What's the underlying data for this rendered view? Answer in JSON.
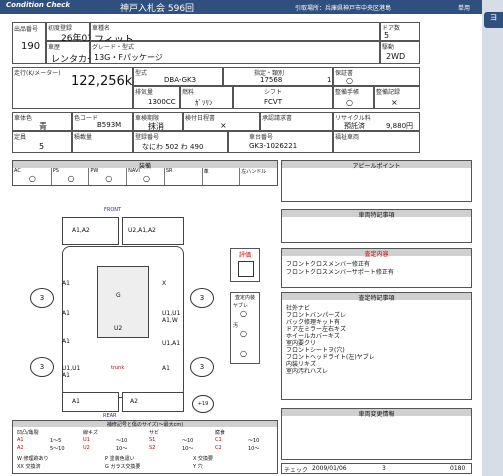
{
  "header": {
    "brand": "Condition Check",
    "auction": "神戸入札会 596回",
    "location": "引取場所：兵庫県神戸市中央区港島",
    "mode": "単用"
  },
  "side_tab": "ヨ",
  "vehicle": {
    "lot_label": "出品番号",
    "lot": "190",
    "first_reg_label": "初度登録",
    "first_reg": "26年03月",
    "name_label": "車種名",
    "name": "フィット",
    "doors_label": "ドア数",
    "doors": "5",
    "type_label": "車歴",
    "type": "レンタカー",
    "grade_label": "グレード・型式",
    "grade": "13G・Fパッケージ",
    "drive_label": "駆動",
    "drive": "2WD",
    "mileage_label": "走行(K/メーター)",
    "mileage": "122,256km",
    "model_label": "型式",
    "model": "DBA-GK3",
    "designation_label": "指定・類別",
    "designation": "17568",
    "category": "1",
    "warranty_label": "保証書",
    "warranty": "○",
    "displacement_label": "排気量",
    "displacement": "1300CC",
    "fuel_label": "燃料",
    "fuel": "ｶﾞｿﾘﾝ",
    "transmission_label": "シフト",
    "transmission": "FCVT",
    "manual_label": "整備手帳",
    "manual": "○",
    "maint_label": "整備記録",
    "maint": "×",
    "color_label": "車体色",
    "color": "青",
    "color_code_label": "色コード",
    "color_code": "B593M",
    "inspect_label": "車検期限",
    "inspect": "抹消",
    "reg_label": "検付日程書",
    "reg": "×",
    "cert_label": "承認請求書",
    "recycle_label": "リサイクル料",
    "recycle_status": "預託済",
    "recycle_fee": "9,880円",
    "capacity_label": "定員",
    "capacity": "5",
    "load_label": "積載量",
    "plate_label": "登録番号",
    "plate": "なにわ 502 わ 490",
    "chassis_label": "車台番号",
    "chassis": "GK3-1026221",
    "welfare_label": "福祉車両"
  },
  "equipment": {
    "title": "装備",
    "headers": [
      "AC",
      "PS",
      "PW",
      "NAVI",
      "SR",
      "革",
      "左ハンドル"
    ],
    "values": [
      "○",
      "○",
      "○",
      "○",
      "",
      "",
      ""
    ]
  },
  "appeal": {
    "title": "アピールポイント"
  },
  "notes_title": "車両特記事項",
  "rating": {
    "label": "評価",
    "value": "",
    "interior_title": "内装評価",
    "interior": ""
  },
  "checks": {
    "title": "査定内容",
    "items": [
      "フロントクロスメンバー修正有",
      "フロントクロスメンバーサポート修正有"
    ]
  },
  "sale_notes": {
    "title": "査定特記事項",
    "items": [
      "社外ナビ",
      "フロントバンパーズレ",
      "バック修理キット有",
      "ドア左ミラー左右キズ",
      "ホイールカバーキズ",
      "室内要クリ",
      "フロントシートヲ(穴)",
      "フロントヘッドライト(左)ヤブレ",
      "内装リキズ",
      "室内汚れハズレ"
    ]
  },
  "history": {
    "title": "車両変更情報"
  },
  "interior_eval": {
    "title": "査定内装",
    "rows": [
      {
        "label": "ヤブレ",
        "value": "○"
      },
      {
        "label": "汚",
        "value": "○"
      },
      {
        "label": "",
        "value": "○"
      }
    ]
  },
  "diagram": {
    "front": "FRONT",
    "rear": "REAR",
    "trunk": "trunk",
    "marks": [
      {
        "id": "front-left",
        "text": "A1,A2"
      },
      {
        "id": "front-right",
        "text": "U2,A1,A2"
      },
      {
        "id": "fender-left",
        "text": "A1"
      },
      {
        "id": "fender-right",
        "text": "X"
      },
      {
        "id": "door-fl",
        "text": "A1"
      },
      {
        "id": "door-fr",
        "text": "U1,U1\nA1,W"
      },
      {
        "id": "door-rl",
        "text": "A1"
      },
      {
        "id": "door-rr",
        "text": "U1,A1"
      },
      {
        "id": "rear-left",
        "text": "U1,U1\nA1"
      },
      {
        "id": "rear-right",
        "text": "A1"
      },
      {
        "id": "roof",
        "text": "U2"
      },
      {
        "id": "hood",
        "text": "G"
      },
      {
        "id": "bumper-rear-left",
        "text": "A1"
      },
      {
        "id": "bumper-rear-right",
        "text": "A2"
      }
    ],
    "tire_labels": [
      "3",
      "3",
      "3",
      "3"
    ],
    "spare": "+19"
  },
  "legend": {
    "title": "補修記号と傷のサイズ(～最大cm)",
    "headers": [
      "凹凸/亀裂",
      "線キズ",
      "サビ",
      "腐食"
    ],
    "rows": [
      [
        "A1",
        "1～5",
        "U1",
        "～10",
        "S1",
        "～10",
        "C1",
        "～10"
      ],
      [
        "A2",
        "5～10",
        "U2",
        "10～",
        "S2",
        "10～",
        "C2",
        "10～"
      ]
    ],
    "footer": [
      "W 修理跡あり",
      "P 塗装色違い",
      "X 交換要",
      "XX 交換済",
      "G ガラス交換要",
      "Y 穴"
    ]
  },
  "check_row": {
    "label": "チェック",
    "date": "2009/01/06",
    "num": "3",
    "code": "0180"
  }
}
